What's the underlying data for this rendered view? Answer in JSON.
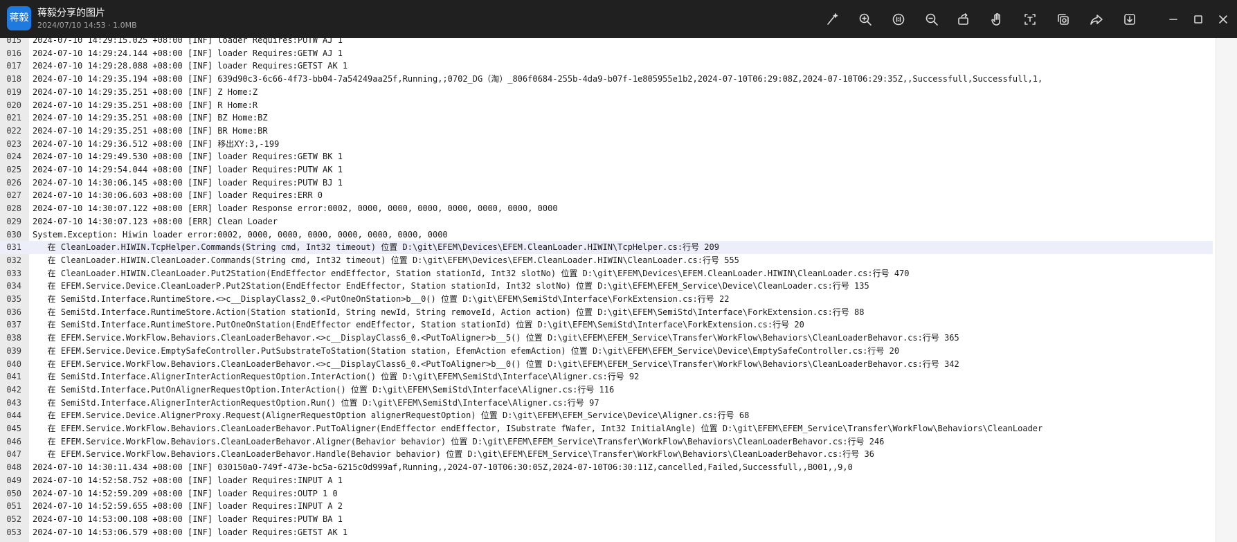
{
  "window": {
    "app_icon_text": "蒋毅",
    "title": "蒋毅分享的图片",
    "subtitle": "2024/07/10 14:53 · 1.0MB"
  },
  "toolbar": {
    "icons": [
      "magic-wand-icon",
      "zoom-in-icon",
      "fit-screen-icon",
      "zoom-out-icon",
      "rotate-icon",
      "hand-icon",
      "ocr-icon",
      "copy-icon",
      "share-icon",
      "download-icon",
      "minimize-icon",
      "maximize-icon",
      "close-icon"
    ]
  },
  "log": {
    "highlighted_line": "031",
    "lines": [
      {
        "n": "015",
        "t": "2024-07-10 14:29:15.025 +08:00 [INF] loader Requires:PUTW AJ 1"
      },
      {
        "n": "016",
        "t": "2024-07-10 14:29:24.144 +08:00 [INF] loader Requires:GETW AJ 1"
      },
      {
        "n": "017",
        "t": "2024-07-10 14:29:28.088 +08:00 [INF] loader Requires:GETST AK 1"
      },
      {
        "n": "018",
        "t": "2024-07-10 14:29:35.194 +08:00 [INF] 639d90c3-6c66-4f73-bb04-7a54249aa25f,Running,;0702_DG（淘）_806f0684-255b-4da9-b07f-1e805955e1b2,2024-07-10T06:29:08Z,2024-07-10T06:29:35Z,,Successfull,Successfull,1,"
      },
      {
        "n": "019",
        "t": "2024-07-10 14:29:35.251 +08:00 [INF] Z Home:Z"
      },
      {
        "n": "020",
        "t": "2024-07-10 14:29:35.251 +08:00 [INF] R Home:R"
      },
      {
        "n": "021",
        "t": "2024-07-10 14:29:35.251 +08:00 [INF] BZ Home:BZ"
      },
      {
        "n": "022",
        "t": "2024-07-10 14:29:35.251 +08:00 [INF] BR Home:BR"
      },
      {
        "n": "023",
        "t": "2024-07-10 14:29:36.512 +08:00 [INF] 移出XY:3,-199"
      },
      {
        "n": "024",
        "t": "2024-07-10 14:29:49.530 +08:00 [INF] loader Requires:GETW BK 1"
      },
      {
        "n": "025",
        "t": "2024-07-10 14:29:54.044 +08:00 [INF] loader Requires:PUTW AK 1"
      },
      {
        "n": "026",
        "t": "2024-07-10 14:30:06.145 +08:00 [INF] loader Requires:PUTW BJ 1"
      },
      {
        "n": "027",
        "t": "2024-07-10 14:30:06.603 +08:00 [INF] loader Requires:ERR 0"
      },
      {
        "n": "028",
        "t": "2024-07-10 14:30:07.122 +08:00 [ERR] loader Response error:0002, 0000, 0000, 0000, 0000, 0000, 0000, 0000"
      },
      {
        "n": "029",
        "t": "2024-07-10 14:30:07.123 +08:00 [ERR] Clean Loader"
      },
      {
        "n": "030",
        "t": "System.Exception: Hiwin loader error:0002, 0000, 0000, 0000, 0000, 0000, 0000, 0000"
      },
      {
        "n": "031",
        "t": "   在 CleanLoader.HIWIN.TcpHelper.Commands(String cmd, Int32 timeout) 位置 D:\\git\\EFEM\\Devices\\EFEM.CleanLoader.HIWIN\\TcpHelper.cs:行号 209"
      },
      {
        "n": "032",
        "t": "   在 CleanLoader.HIWIN.CleanLoader.Commands(String cmd, Int32 timeout) 位置 D:\\git\\EFEM\\Devices\\EFEM.CleanLoader.HIWIN\\CleanLoader.cs:行号 555"
      },
      {
        "n": "033",
        "t": "   在 CleanLoader.HIWIN.CleanLoader.Put2Station(EndEffector endEffector, Station stationId, Int32 slotNo) 位置 D:\\git\\EFEM\\Devices\\EFEM.CleanLoader.HIWIN\\CleanLoader.cs:行号 470"
      },
      {
        "n": "034",
        "t": "   在 EFEM.Service.Device.CleanLoaderP.Put2Station(EndEffector EndEffector, Station stationId, Int32 slotNo) 位置 D:\\git\\EFEM\\EFEM_Service\\Device\\CleanLoader.cs:行号 135"
      },
      {
        "n": "035",
        "t": "   在 SemiStd.Interface.RuntimeStore.<>c__DisplayClass2_0.<PutOneOnStation>b__0() 位置 D:\\git\\EFEM\\SemiStd\\Interface\\ForkExtension.cs:行号 22"
      },
      {
        "n": "036",
        "t": "   在 SemiStd.Interface.RuntimeStore.Action(Station stationId, String newId, String removeId, Action action) 位置 D:\\git\\EFEM\\SemiStd\\Interface\\ForkExtension.cs:行号 88"
      },
      {
        "n": "037",
        "t": "   在 SemiStd.Interface.RuntimeStore.PutOneOnStation(EndEffector endEffector, Station stationId) 位置 D:\\git\\EFEM\\SemiStd\\Interface\\ForkExtension.cs:行号 20"
      },
      {
        "n": "038",
        "t": "   在 EFEM.Service.WorkFlow.Behaviors.CleanLoaderBehavor.<>c__DisplayClass6_0.<PutToAligner>b__5() 位置 D:\\git\\EFEM\\EFEM_Service\\Transfer\\WorkFlow\\Behaviors\\CleanLoaderBehavor.cs:行号 365"
      },
      {
        "n": "039",
        "t": "   在 EFEM.Service.Device.EmptySafeController.PutSubstrateToStation(Station station, EfemAction efemAction) 位置 D:\\git\\EFEM\\EFEM_Service\\Device\\EmptySafeController.cs:行号 20"
      },
      {
        "n": "040",
        "t": "   在 EFEM.Service.WorkFlow.Behaviors.CleanLoaderBehavor.<>c__DisplayClass6_0.<PutToAligner>b__0() 位置 D:\\git\\EFEM\\EFEM_Service\\Transfer\\WorkFlow\\Behaviors\\CleanLoaderBehavor.cs:行号 342"
      },
      {
        "n": "041",
        "t": "   在 SemiStd.Interface.AlignerInterActionRequestOption.InterAction() 位置 D:\\git\\EFEM\\SemiStd\\Interface\\Aligner.cs:行号 92"
      },
      {
        "n": "042",
        "t": "   在 SemiStd.Interface.PutOnAlignerRequestOption.InterAction() 位置 D:\\git\\EFEM\\SemiStd\\Interface\\Aligner.cs:行号 116"
      },
      {
        "n": "043",
        "t": "   在 SemiStd.Interface.AlignerInterActionRequestOption.Run() 位置 D:\\git\\EFEM\\SemiStd\\Interface\\Aligner.cs:行号 97"
      },
      {
        "n": "044",
        "t": "   在 EFEM.Service.Device.AlignerProxy.Request(AlignerRequestOption alignerRequestOption) 位置 D:\\git\\EFEM\\EFEM_Service\\Device\\Aligner.cs:行号 68"
      },
      {
        "n": "045",
        "t": "   在 EFEM.Service.WorkFlow.Behaviors.CleanLoaderBehavor.PutToAligner(EndEffector endEffector, ISubstrate fWafer, Int32 InitialAngle) 位置 D:\\git\\EFEM\\EFEM_Service\\Transfer\\WorkFlow\\Behaviors\\CleanLoader"
      },
      {
        "n": "046",
        "t": "   在 EFEM.Service.WorkFlow.Behaviors.CleanLoaderBehavor.Aligner(Behavior behavior) 位置 D:\\git\\EFEM\\EFEM_Service\\Transfer\\WorkFlow\\Behaviors\\CleanLoaderBehavor.cs:行号 246"
      },
      {
        "n": "047",
        "t": "   在 EFEM.Service.WorkFlow.Behaviors.CleanLoaderBehavor.Handle(Behavior behavior) 位置 D:\\git\\EFEM\\EFEM_Service\\Transfer\\WorkFlow\\Behaviors\\CleanLoaderBehavor.cs:行号 36"
      },
      {
        "n": "048",
        "t": "2024-07-10 14:30:11.434 +08:00 [INF] 030150a0-749f-473e-bc5a-6215c0d999af,Running,,2024-07-10T06:30:05Z,2024-07-10T06:30:11Z,cancelled,Failed,Successfull,,B001,,9,0"
      },
      {
        "n": "049",
        "t": "2024-07-10 14:52:58.752 +08:00 [INF] loader Requires:INPUT A 1"
      },
      {
        "n": "050",
        "t": "2024-07-10 14:52:59.209 +08:00 [INF] loader Requires:OUTP 1 0"
      },
      {
        "n": "051",
        "t": "2024-07-10 14:52:59.655 +08:00 [INF] loader Requires:INPUT A 2"
      },
      {
        "n": "052",
        "t": "2024-07-10 14:53:00.108 +08:00 [INF] loader Requires:PUTW BA 1"
      },
      {
        "n": "053",
        "t": "2024-07-10 14:53:06.579 +08:00 [INF] loader Requires:GETST AK 1"
      }
    ]
  }
}
